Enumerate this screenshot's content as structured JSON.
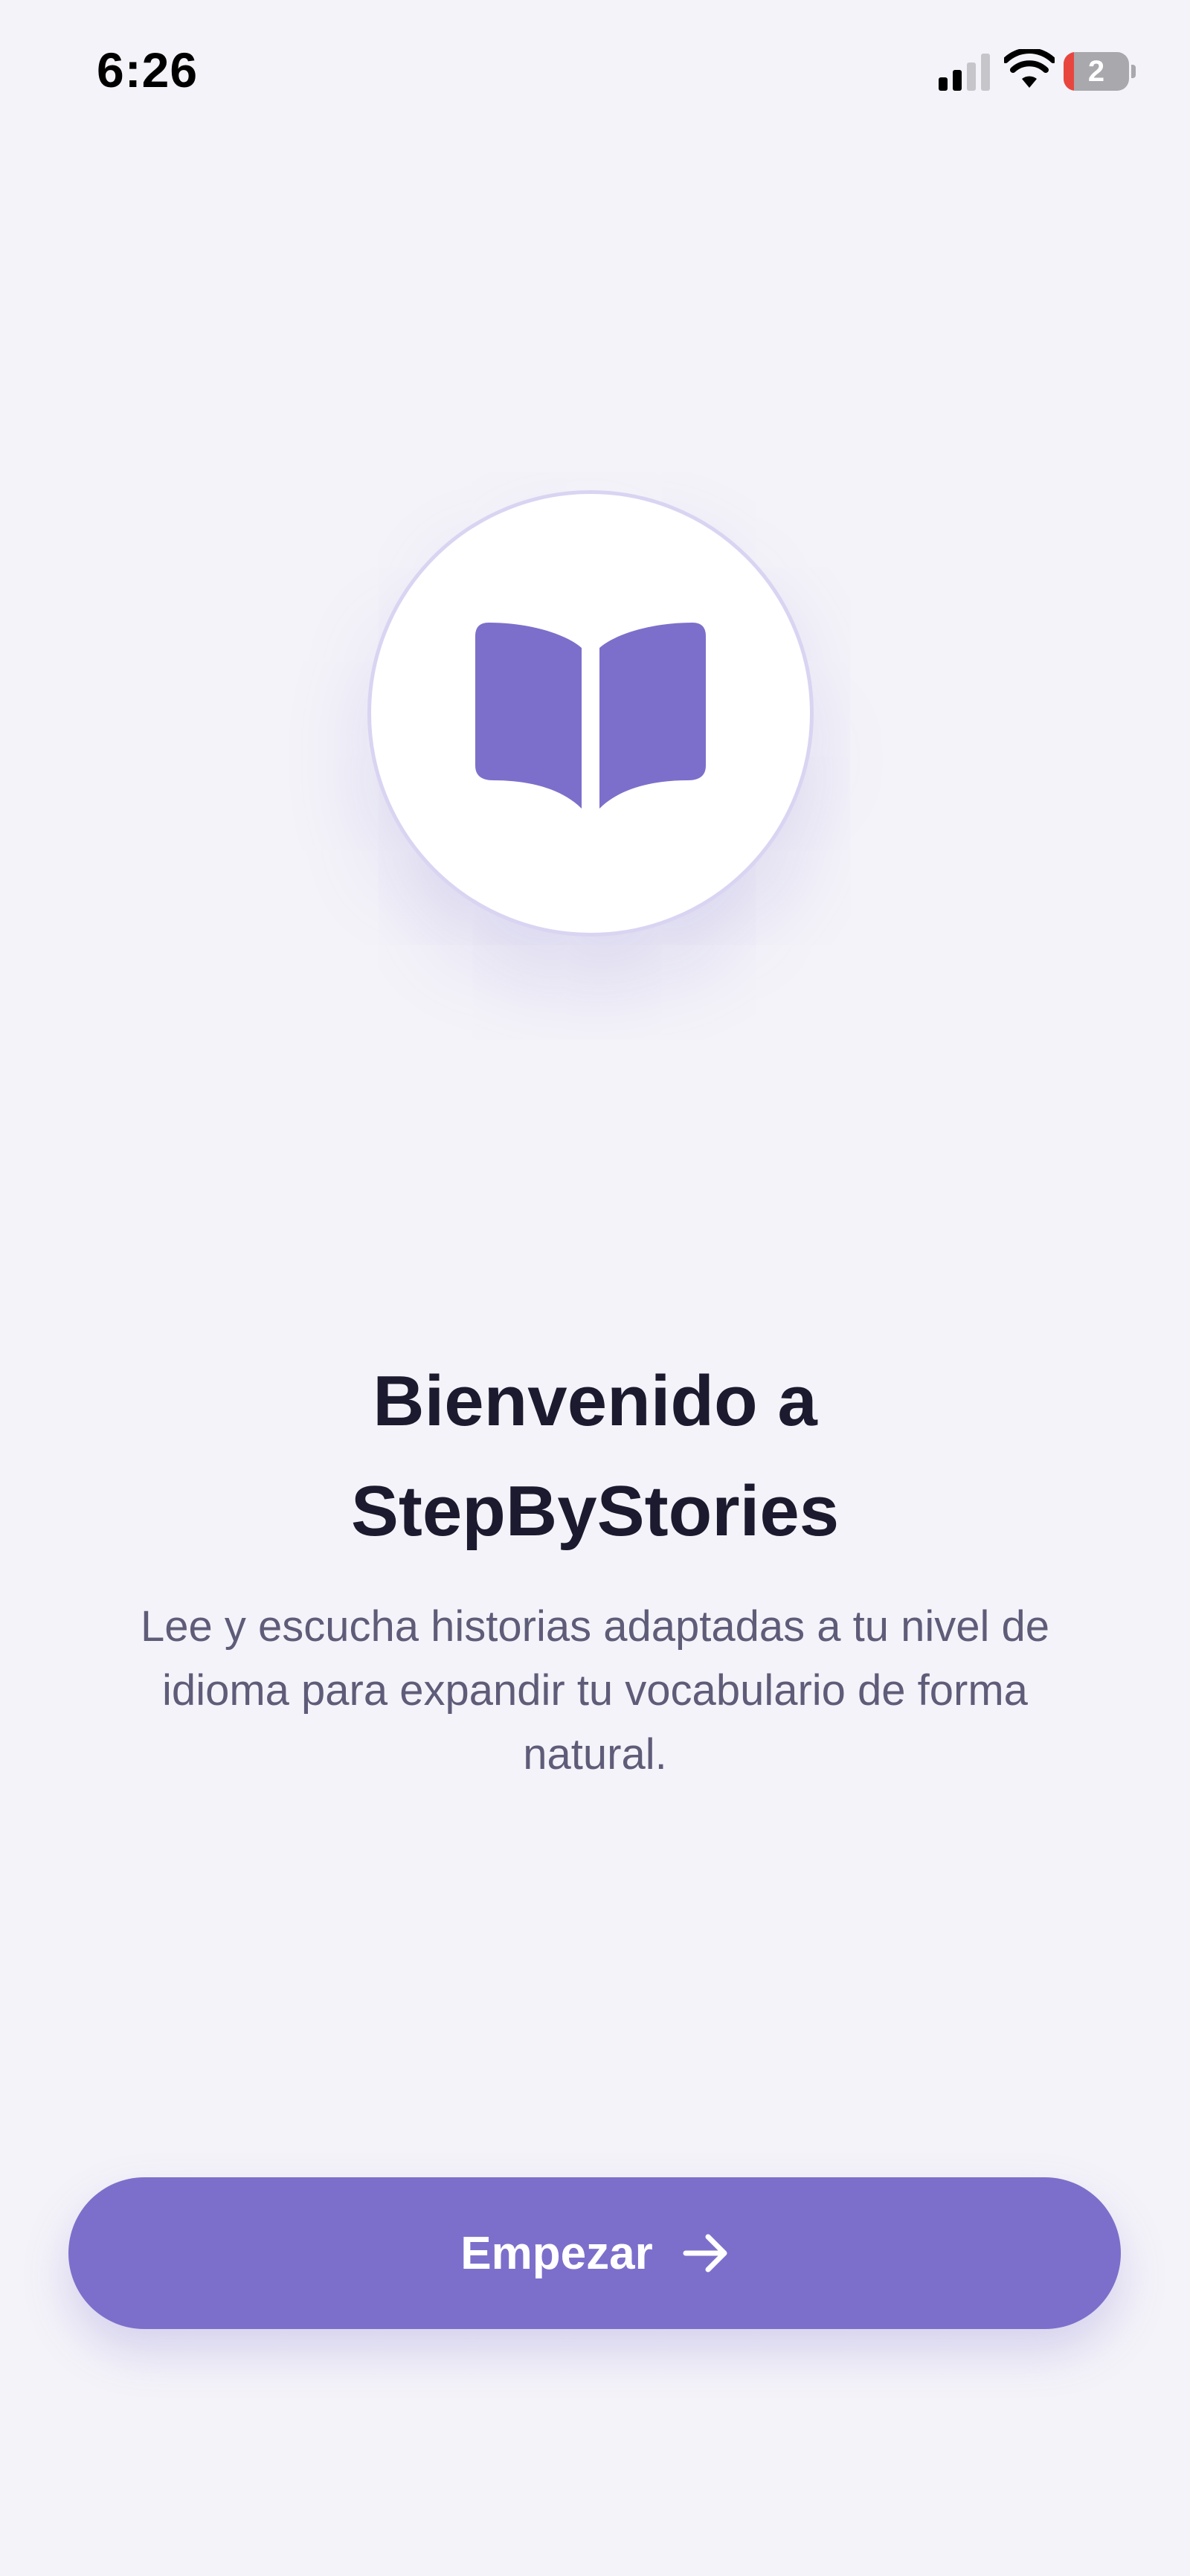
{
  "status_bar": {
    "time": "6:26",
    "battery_level": "2",
    "icons": [
      "signal-icon",
      "wifi-icon",
      "battery-icon"
    ]
  },
  "logo": {
    "icon": "book-icon"
  },
  "welcome": {
    "title_line1": "Bienvenido a",
    "title_line2": "StepByStories",
    "description": "Lee y escucha historias adaptadas a tu nivel de idioma para expandir tu vocabulario de forma natural."
  },
  "start_button": {
    "label": "Empezar",
    "icon": "arrow-right-icon"
  },
  "colors": {
    "background": "#f4f3f9",
    "accent": "#7c6fcb",
    "title": "#1b1a2e",
    "body_text": "#5e5c78",
    "card": "#ffffff"
  }
}
